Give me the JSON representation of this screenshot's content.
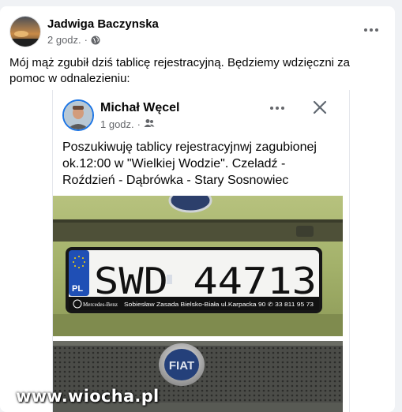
{
  "post": {
    "author": "Jadwiga Baczynska",
    "time": "2 godz.",
    "privacy_icon": "globe-icon",
    "more_icon": "more-horizontal-icon",
    "text": "Mój mąż zgubił dziś tablicę rejestracyjną. Będziemy wdzięczni za pomoc w odnalezieniu:"
  },
  "shared_post": {
    "author": "Michał Węcel",
    "time": "1 godz.",
    "audience_icon": "friends-icon",
    "more_icon": "more-horizontal-icon",
    "close_icon": "close-icon",
    "text": "Poszukiwuję tablicy rejestracyjnwj zagubionej ok.12:00 w \"Wielkiej Wodzie\". Czeladź - Roździeń - Dąbrówka - Stary Sosnowiec",
    "plate": {
      "country": "PL",
      "number": "SWD 44713",
      "dealer_logo": "Mercedes-Benz",
      "dealer_line": "Sobiesław Zasada Bielsko-Biała ul.Karpacka 90 ✆ 33 811 95 73"
    },
    "badge": "FIAT"
  },
  "watermark": "www.wiocha.pl",
  "colors": {
    "facebook_blue": "#1b74e4",
    "secondary_text": "#65676b",
    "car_paint": "#a3b16a",
    "eu_blue": "#1f4fb5"
  }
}
